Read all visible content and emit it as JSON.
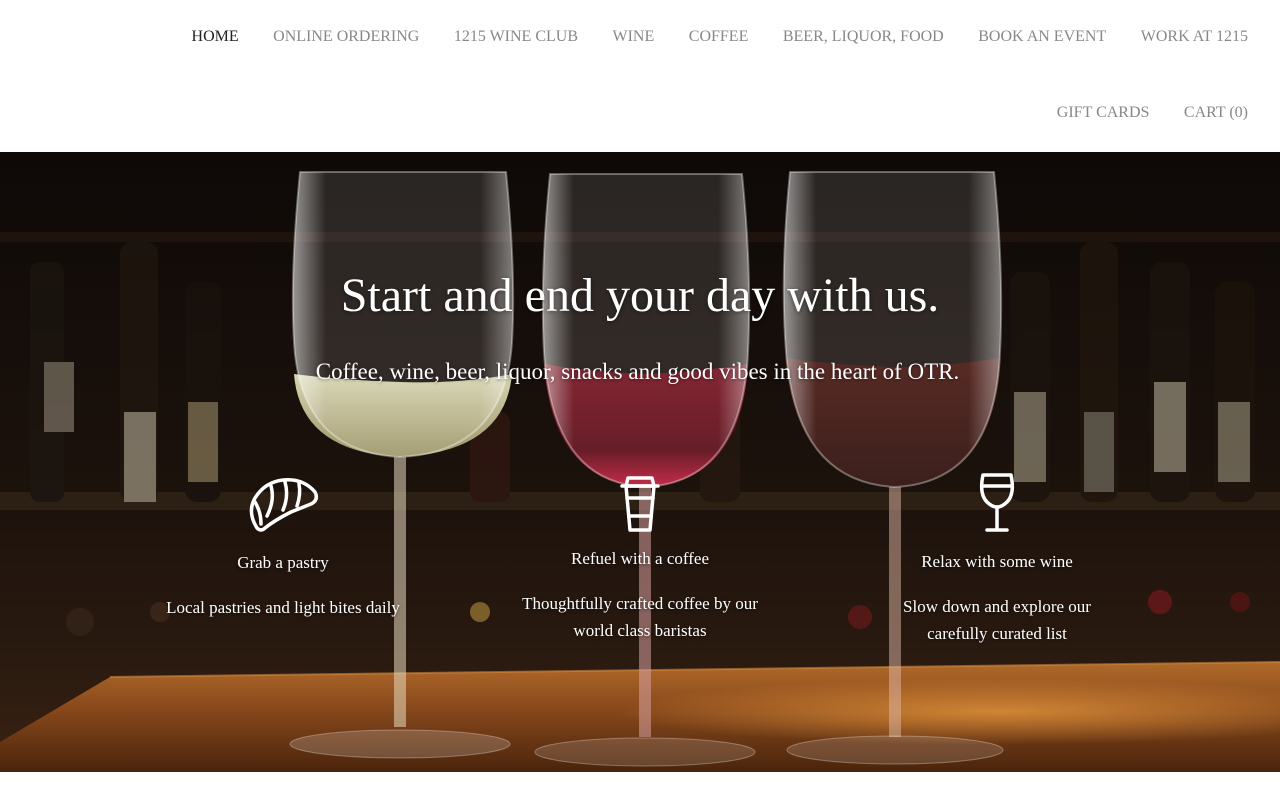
{
  "nav": {
    "row1": [
      {
        "label": "HOME",
        "active": true
      },
      {
        "label": "ONLINE ORDERING",
        "active": false
      },
      {
        "label": "1215 WINE CLUB",
        "active": false
      },
      {
        "label": "WINE",
        "active": false
      },
      {
        "label": "COFFEE",
        "active": false
      },
      {
        "label": "BEER, LIQUOR, FOOD",
        "active": false
      },
      {
        "label": "BOOK AN EVENT",
        "active": false
      },
      {
        "label": "WORK AT 1215",
        "active": false
      }
    ],
    "row2": [
      {
        "label": "GIFT CARDS",
        "active": false
      },
      {
        "label": "CART (0)",
        "active": false
      }
    ]
  },
  "hero": {
    "headline": "Start and end your day with us.",
    "subline": "Coffee, wine, beer, liquor, snacks and good vibes in the heart of OTR."
  },
  "features": [
    {
      "icon": "croissant-icon",
      "title": "Grab a pastry",
      "description": "Local pastries and light bites daily"
    },
    {
      "icon": "coffee-cup-icon",
      "title": "Refuel with a coffee",
      "description": "Thoughtfully crafted coffee by our world class baristas"
    },
    {
      "icon": "wine-glass-icon",
      "title": "Relax with some wine",
      "description": "Slow down and explore our carefully curated list"
    }
  ],
  "colors": {
    "nav_text": "#888888",
    "nav_active": "#222222",
    "hero_text": "#ffffff",
    "white_wine": "#d9d7a8",
    "red_wine": "#6a0f1c",
    "wood_bar": "#8a4a1c"
  }
}
